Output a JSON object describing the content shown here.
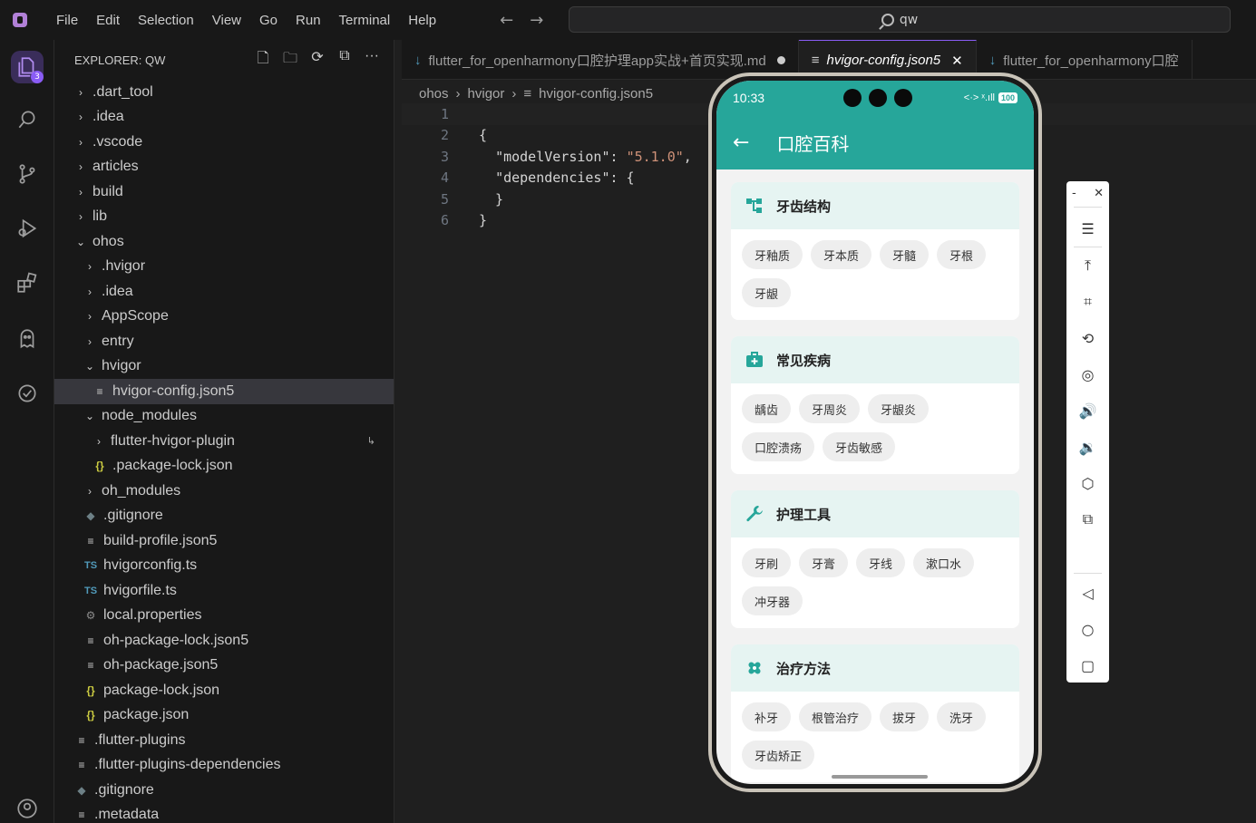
{
  "titlebar": {
    "menu": [
      "File",
      "Edit",
      "Selection",
      "View",
      "Go",
      "Run",
      "Terminal",
      "Help"
    ],
    "search_text": "qw"
  },
  "activity": {
    "badge_count": "3"
  },
  "explorer": {
    "title": "EXPLORER: QW",
    "tree": [
      {
        "label": ".dart_tool",
        "chev": "›",
        "indent": 0,
        "icon": ""
      },
      {
        "label": ".idea",
        "chev": "›",
        "indent": 0,
        "icon": ""
      },
      {
        "label": ".vscode",
        "chev": "›",
        "indent": 0,
        "icon": ""
      },
      {
        "label": "articles",
        "chev": "›",
        "indent": 0,
        "icon": ""
      },
      {
        "label": "build",
        "chev": "›",
        "indent": 0,
        "icon": ""
      },
      {
        "label": "lib",
        "chev": "›",
        "indent": 0,
        "icon": ""
      },
      {
        "label": "ohos",
        "chev": "⌄",
        "indent": 0,
        "icon": ""
      },
      {
        "label": ".hvigor",
        "chev": "›",
        "indent": 1,
        "icon": ""
      },
      {
        "label": ".idea",
        "chev": "›",
        "indent": 1,
        "icon": ""
      },
      {
        "label": "AppScope",
        "chev": "›",
        "indent": 1,
        "icon": ""
      },
      {
        "label": "entry",
        "chev": "›",
        "indent": 1,
        "icon": ""
      },
      {
        "label": "hvigor",
        "chev": "⌄",
        "indent": 1,
        "icon": ""
      },
      {
        "label": "hvigor-config.json5",
        "chev": "",
        "indent": 2,
        "icon": "txt",
        "selected": true
      },
      {
        "label": "node_modules",
        "chev": "⌄",
        "indent": 1,
        "icon": ""
      },
      {
        "label": "flutter-hvigor-plugin",
        "chev": "›",
        "indent": 2,
        "icon": "",
        "link": true
      },
      {
        "label": ".package-lock.json",
        "chev": "",
        "indent": 2,
        "icon": "json"
      },
      {
        "label": "oh_modules",
        "chev": "›",
        "indent": 1,
        "icon": ""
      },
      {
        "label": ".gitignore",
        "chev": "",
        "indent": 1,
        "icon": "git"
      },
      {
        "label": "build-profile.json5",
        "chev": "",
        "indent": 1,
        "icon": "txt"
      },
      {
        "label": "hvigorconfig.ts",
        "chev": "",
        "indent": 1,
        "icon": "ts"
      },
      {
        "label": "hvigorfile.ts",
        "chev": "",
        "indent": 1,
        "icon": "ts"
      },
      {
        "label": "local.properties",
        "chev": "",
        "indent": 1,
        "icon": "gear"
      },
      {
        "label": "oh-package-lock.json5",
        "chev": "",
        "indent": 1,
        "icon": "txt"
      },
      {
        "label": "oh-package.json5",
        "chev": "",
        "indent": 1,
        "icon": "txt"
      },
      {
        "label": "package-lock.json",
        "chev": "",
        "indent": 1,
        "icon": "json"
      },
      {
        "label": "package.json",
        "chev": "",
        "indent": 1,
        "icon": "json"
      },
      {
        "label": ".flutter-plugins",
        "chev": "",
        "indent": 0,
        "icon": "txt"
      },
      {
        "label": ".flutter-plugins-dependencies",
        "chev": "",
        "indent": 0,
        "icon": "txt"
      },
      {
        "label": ".gitignore",
        "chev": "",
        "indent": 0,
        "icon": "git"
      },
      {
        "label": ".metadata",
        "chev": "",
        "indent": 0,
        "icon": "txt"
      }
    ]
  },
  "tabs": [
    {
      "label": "flutter_for_openharmony口腔护理app实战+首页实现.md",
      "icon": "md",
      "dirty": true,
      "active": false
    },
    {
      "label": "hvigor-config.json5",
      "icon": "txt",
      "dirty": false,
      "active": true
    },
    {
      "label": "flutter_for_openharmony口腔",
      "icon": "md",
      "dirty": false,
      "active": false
    }
  ],
  "breadcrumb": [
    "ohos",
    "hvigor",
    "hvigor-config.json5"
  ],
  "code": [
    {
      "n": "1",
      "text": ""
    },
    {
      "n": "2",
      "text": "{"
    },
    {
      "n": "3",
      "text": "  \"modelVersion\": \"5.1.0\","
    },
    {
      "n": "4",
      "text": "  \"dependencies\": {"
    },
    {
      "n": "5",
      "text": "  }"
    },
    {
      "n": "6",
      "text": "}"
    }
  ],
  "phone": {
    "time": "10:33",
    "battery": "100",
    "signal": "<·>  ˣ.ıll",
    "app_title": "口腔百科",
    "sections": [
      {
        "title": "牙齿结构",
        "icon": "structure-icon",
        "items": [
          "牙釉质",
          "牙本质",
          "牙髓",
          "牙根",
          "牙龈"
        ]
      },
      {
        "title": "常见疾病",
        "icon": "medical-kit-icon",
        "items": [
          "龋齿",
          "牙周炎",
          "牙龈炎",
          "口腔溃疡",
          "牙齿敏感"
        ]
      },
      {
        "title": "护理工具",
        "icon": "wrench-icon",
        "items": [
          "牙刷",
          "牙膏",
          "牙线",
          "漱口水",
          "冲牙器"
        ]
      },
      {
        "title": "治疗方法",
        "icon": "bandage-icon",
        "items": [
          "补牙",
          "根管治疗",
          "拔牙",
          "洗牙",
          "牙齿矫正"
        ]
      }
    ],
    "accent": "#26a69a"
  },
  "toolbar": {
    "minimize": "-",
    "close": "✕"
  }
}
